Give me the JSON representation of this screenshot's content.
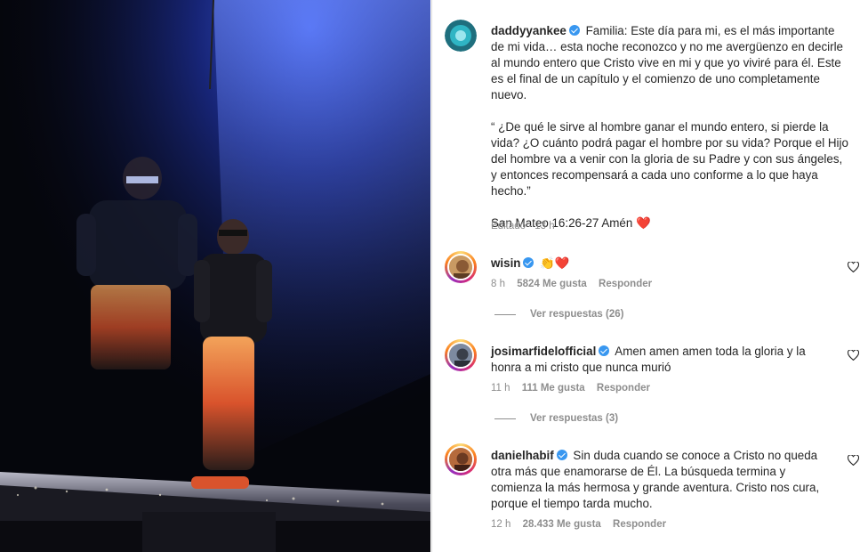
{
  "post": {
    "author": "daddyyankee",
    "caption_p1": "Familia: Este día para mi, es el más importante de mi vida… esta noche reconozco y no me avergüenzo en decirle al mundo entero que Cristo vive en mi y que yo viviré para él. Este es el final de un capítulo y el comienzo de uno completamente nuevo.",
    "caption_p2": "“ ¿De qué le sirve al hombre ganar el mundo entero, si pierde la vida? ¿O cuánto podrá pagar el hombre por su vida? Porque el Hijo del hombre va a venir con la gloria de su Padre y con sus ángeles, y entonces recompensará a cada uno conforme a lo que haya hecho.”",
    "caption_p3": "San Mateo 16:26-27 Amén",
    "caption_p3_emoji": "❤️",
    "edited": "Editado · 13 h"
  },
  "comments": [
    {
      "username": "wisin",
      "text": "👏❤️",
      "time": "8 h",
      "likes": "5824 Me gusta",
      "reply": "Responder",
      "view_replies": "Ver respuestas (26)"
    },
    {
      "username": "josimarfidelofficial",
      "text": "Amen amen amen toda la gloria y la honra a mi cristo que nunca murió",
      "time": "11 h",
      "likes": "111 Me gusta",
      "reply": "Responder",
      "view_replies": "Ver respuestas (3)"
    },
    {
      "username": "danielhabif",
      "text": "Sin duda cuando se conoce a Cristo no queda otra más que enamorarse de Él. La búsqueda termina y comienza la más hermosa y grande aventura. Cristo nos cura, porque el tiempo tarda mucho.",
      "time": "12 h",
      "likes": "28.433 Me gusta",
      "reply": "Responder"
    }
  ],
  "colors": {
    "verified": "#3897f0",
    "secondary_text": "#8e8e8e",
    "heart": "#e0245e"
  },
  "icons": [
    "verified-badge-icon",
    "heart-outline-icon"
  ]
}
